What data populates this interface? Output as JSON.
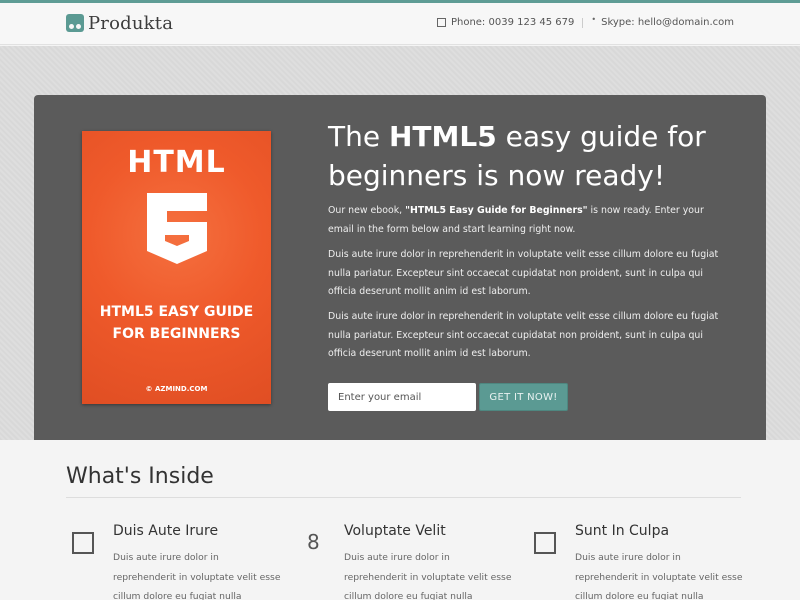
{
  "header": {
    "brand": "Produkta",
    "phone": "Phone: 0039 123 45 679",
    "skype": "Skype: hello@domain.com"
  },
  "hero": {
    "book": {
      "html_label": "HTML",
      "five_label": "5",
      "title_line1": "HTML5 EASY GUIDE",
      "title_line2": "FOR BEGINNERS",
      "brand": "© AZMIND.COM"
    },
    "title_pre": "The ",
    "title_bold": "HTML5",
    "title_post": " easy guide for beginners is now ready!",
    "intro_pre": "Our new ebook, ",
    "intro_bold": "\"HTML5 Easy Guide for Beginners\"",
    "intro_post": " is now ready. Enter your email in the form below and start learning right now.",
    "paragraph1": "Duis aute irure dolor in reprehenderit in voluptate velit esse cillum dolore eu fugiat nulla pariatur. Excepteur sint occaecat cupidatat non proident, sunt in culpa qui officia deserunt mollit anim id est laborum.",
    "paragraph2": "Duis aute irure dolor in reprehenderit in voluptate velit esse cillum dolore eu fugiat nulla pariatur. Excepteur sint occaecat cupidatat non proident, sunt in culpa qui officia deserunt mollit anim id est laborum.",
    "email_placeholder": "Enter your email",
    "cta_label": "GET IT NOW!"
  },
  "whats_inside": {
    "title": "What's Inside",
    "features": [
      {
        "icon": "square-icon",
        "title": "Duis Aute Irure",
        "text": "Duis aute irure dolor in reprehenderit in voluptate velit esse cillum dolore eu fugiat nulla pariatur. Excepteur sint"
      },
      {
        "icon": "number-8-icon",
        "icon_text": "8",
        "title": "Voluptate Velit",
        "text": "Duis aute irure dolor in reprehenderit in voluptate velit esse cillum dolore eu fugiat nulla pariatur. Excepteur sint"
      },
      {
        "icon": "square-icon",
        "title": "Sunt In Culpa",
        "text": "Duis aute irure dolor in reprehenderit in voluptate velit esse cillum dolore eu fugiat nulla pariatur. Excepteur sint"
      }
    ]
  },
  "colors": {
    "accent": "#5b9a93",
    "hero_bg": "#5b5b5b",
    "book_orange": "#ef5a2b"
  }
}
